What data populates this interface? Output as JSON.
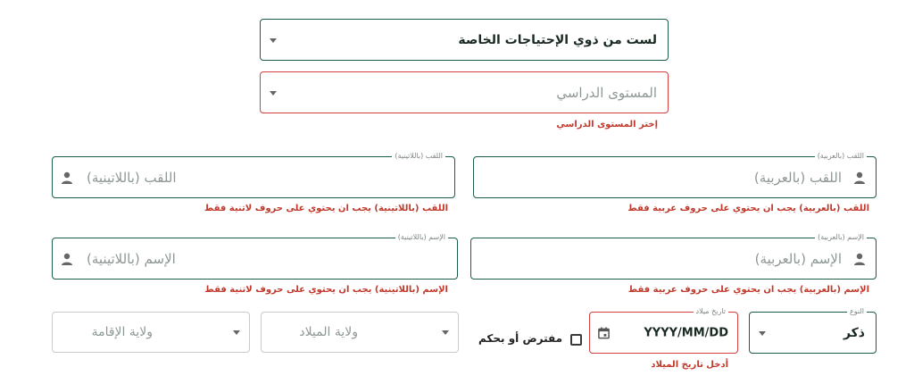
{
  "disability_select": {
    "value": "لست من ذوي الإحتياجات الخاصة"
  },
  "study_level_select": {
    "placeholder": "المستوى الدراسي",
    "error": "إختر المستوى الدراسي"
  },
  "lastname_latin": {
    "legend": "اللقب (باللاتينية)",
    "placeholder": "اللقب (باللاتينية)",
    "error": "اللقب (باللاتينية) يجب ان يحتوي على حروف لاتنية فقط",
    "icon": "person-icon"
  },
  "lastname_arabic": {
    "legend": "اللقب (بالعربية)",
    "placeholder": "اللقب (بالعربية)",
    "error": "اللقب (بالعربية) يجب ان يحتوي على حروف عربية فقط",
    "icon": "person-icon"
  },
  "firstname_latin": {
    "legend": "الإسم (باللاتينية)",
    "placeholder": "الإسم (باللاتينية)",
    "error": "الإسم (باللاتينية) يجب ان يحتوي على حروف لاتنية فقط",
    "icon": "person-icon"
  },
  "firstname_arabic": {
    "legend": "الإسم (بالعربية)",
    "placeholder": "الإسم (بالعربية)",
    "error": "الإسم (بالعربية) يجب ان يحتوي على حروف عربية فقط",
    "icon": "person-icon"
  },
  "residence_state_select": {
    "placeholder": "ولاية الإقامة"
  },
  "birth_state_select": {
    "placeholder": "ولاية الميلاد"
  },
  "presumed_checkbox": {
    "label": "مفترض أو بحكم",
    "checked": false
  },
  "birth_date": {
    "legend": "تاريخ ميلاد",
    "placeholder": "YYYY/MM/DD",
    "error": "أدخل تاريخ الميلاد",
    "icon": "calendar-icon"
  },
  "gender_select": {
    "legend": "النوع",
    "value": "ذكر"
  },
  "colors": {
    "primary": "#1d5c46",
    "error": "#d13f3f",
    "error_text": "#c0392b",
    "placeholder": "#8e9893"
  }
}
